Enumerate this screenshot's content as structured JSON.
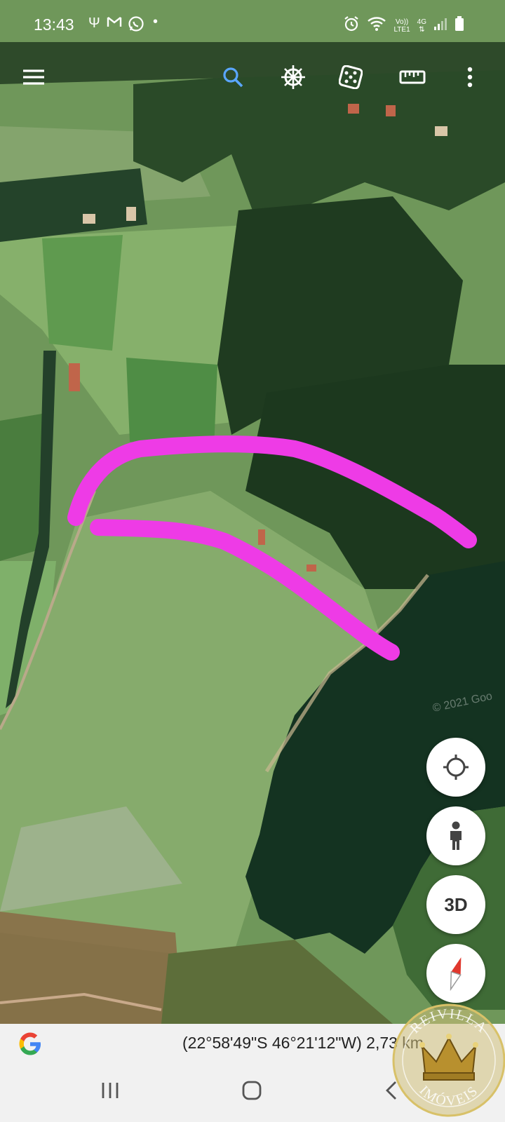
{
  "status_bar": {
    "time": "13:43",
    "left_icons": [
      "usb-icon",
      "gmail-icon",
      "whatsapp-icon",
      "dot-icon"
    ],
    "network_top": "Vo))",
    "network_bottom": "LTE1",
    "data_label": "4G",
    "right_icons": [
      "alarm-icon",
      "wifi-icon",
      "signal-icon",
      "battery-icon"
    ]
  },
  "toolbar": {
    "buttons": [
      "menu-icon",
      "search-icon",
      "voyager-wheel-icon",
      "dice-icon",
      "ruler-icon",
      "more-vert-icon"
    ]
  },
  "map": {
    "copyright": "© 2021 Goo",
    "annotation_color": "#ee3be6",
    "water_color": "#143321",
    "field_color": "#7fa665",
    "forest_color": "#1e3a1f"
  },
  "fabs": {
    "three_d_label": "3D",
    "icons": [
      "my-location-icon",
      "pegman-icon",
      "compass-icon"
    ]
  },
  "info_bar": {
    "coordinates": "(22°58'49\"S 46°21'12\"W) 2,73 km"
  },
  "nav_bar": {
    "icons": [
      "recent-apps-icon",
      "home-icon",
      "back-icon"
    ]
  },
  "watermark": {
    "top_text": "REIVILLA",
    "bottom_text": "IMÓVEIS",
    "color": "#d8c168"
  }
}
